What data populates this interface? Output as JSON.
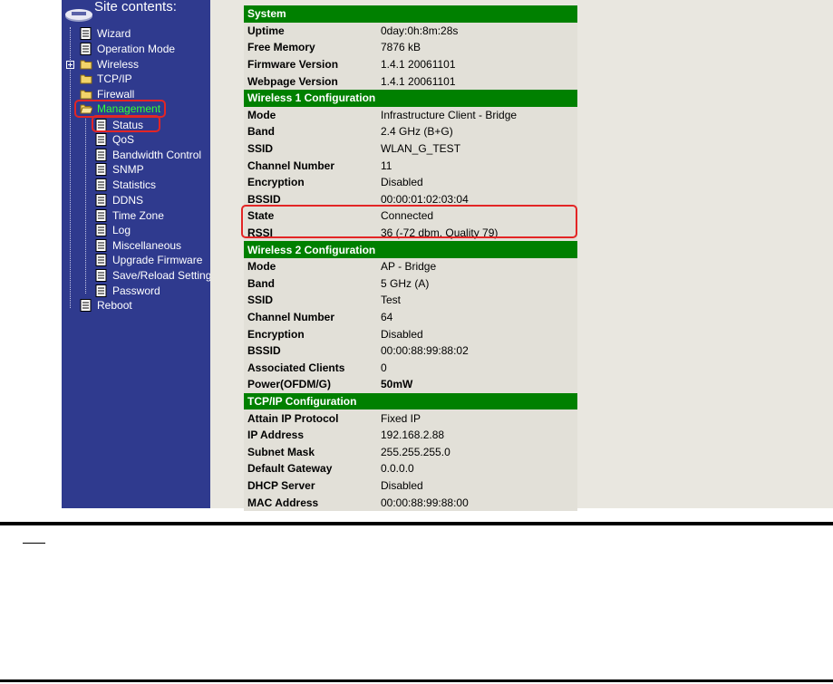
{
  "sidebar": {
    "title": "Site contents:",
    "items": [
      {
        "label": "Wizard"
      },
      {
        "label": "Operation Mode"
      },
      {
        "label": "Wireless"
      },
      {
        "label": "TCP/IP"
      },
      {
        "label": "Firewall"
      },
      {
        "label": "Management"
      },
      {
        "label": "Status"
      },
      {
        "label": "QoS"
      },
      {
        "label": "Bandwidth Control"
      },
      {
        "label": "SNMP"
      },
      {
        "label": "Statistics"
      },
      {
        "label": "DDNS"
      },
      {
        "label": "Time Zone"
      },
      {
        "label": "Log"
      },
      {
        "label": "Miscellaneous"
      },
      {
        "label": "Upgrade Firmware"
      },
      {
        "label": "Save/Reload Setting"
      },
      {
        "label": "Password"
      },
      {
        "label": "Reboot"
      }
    ]
  },
  "status": {
    "system": {
      "header": "System",
      "rows": [
        {
          "key": "Uptime",
          "value": "0day:0h:8m:28s"
        },
        {
          "key": "Free Memory",
          "value": "7876 kB"
        },
        {
          "key": "Firmware Version",
          "value": "1.4.1 20061101"
        },
        {
          "key": "Webpage Version",
          "value": "1.4.1 20061101"
        }
      ]
    },
    "wireless1": {
      "header": "Wireless 1 Configuration",
      "rows": [
        {
          "key": "Mode",
          "value": "Infrastructure Client - Bridge"
        },
        {
          "key": "Band",
          "value": "2.4 GHz (B+G)"
        },
        {
          "key": "SSID",
          "value": "WLAN_G_TEST"
        },
        {
          "key": "Channel Number",
          "value": "11"
        },
        {
          "key": "Encryption",
          "value": "Disabled"
        },
        {
          "key": "BSSID",
          "value": "00:00:01:02:03:04"
        },
        {
          "key": "State",
          "value": "Connected"
        },
        {
          "key": "RSSI",
          "value": "36 (-72 dbm, Quality 79)"
        }
      ]
    },
    "wireless2": {
      "header": "Wireless 2 Configuration",
      "rows": [
        {
          "key": "Mode",
          "value": "AP - Bridge"
        },
        {
          "key": "Band",
          "value": "5 GHz (A)"
        },
        {
          "key": "SSID",
          "value": "Test"
        },
        {
          "key": "Channel Number",
          "value": "64"
        },
        {
          "key": "Encryption",
          "value": "Disabled"
        },
        {
          "key": "BSSID",
          "value": "00:00:88:99:88:02"
        },
        {
          "key": "Associated Clients",
          "value": "0"
        },
        {
          "key": "Power(OFDM/G)",
          "value": "50mW"
        }
      ]
    },
    "tcpip": {
      "header": "TCP/IP Configuration",
      "rows": [
        {
          "key": "Attain IP Protocol",
          "value": "Fixed IP"
        },
        {
          "key": "IP Address",
          "value": "192.168.2.88"
        },
        {
          "key": "Subnet Mask",
          "value": "255.255.255.0"
        },
        {
          "key": "Default Gateway",
          "value": "0.0.0.0"
        },
        {
          "key": "DHCP Server",
          "value": "Disabled"
        },
        {
          "key": "MAC Address",
          "value": "00:00:88:99:88:00"
        }
      ]
    }
  },
  "colors": {
    "sidebar_bg": "#2f3a8e",
    "header_green": "#008000",
    "highlight_red": "#e32525",
    "active_green": "#33ff33"
  },
  "icons": {
    "page": "page-icon",
    "folder": "folder-icon",
    "folder_open": "folder-open-icon",
    "logo": "site-contents-icon"
  }
}
